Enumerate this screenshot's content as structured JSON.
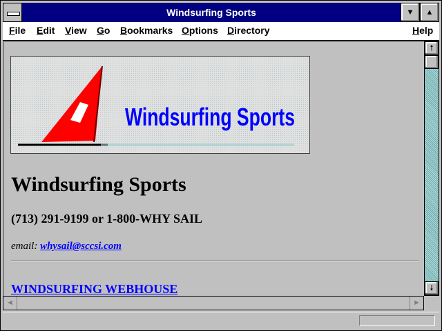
{
  "window": {
    "title": "Windsurfing Sports",
    "minimize_glyph": "▼",
    "maximize_glyph": "▲"
  },
  "menu": {
    "items": [
      {
        "label": "File",
        "u": "F"
      },
      {
        "label": "Edit",
        "u": "E"
      },
      {
        "label": "View",
        "u": "V"
      },
      {
        "label": "Go",
        "u": "G"
      },
      {
        "label": "Bookmarks",
        "u": "B"
      },
      {
        "label": "Options",
        "u": "O"
      },
      {
        "label": "Directory",
        "u": "D"
      },
      {
        "label": "Help",
        "u": "H"
      }
    ]
  },
  "page": {
    "banner_text": "Windsurfing Sports",
    "heading": "Windsurfing Sports",
    "phone": "(713) 291-9199 or 1-800-WHY SAIL",
    "email_label": "email:",
    "email_link": "whysail@sccsi.com",
    "webhouse_link": "WINDSURFING WEBHOUSE"
  },
  "scroll": {
    "up_glyph": "🠕",
    "down_glyph": "🠗",
    "left_glyph": "◄",
    "right_glyph": "►"
  },
  "colors": {
    "titlebar": "#000080",
    "sail": "#ff0000",
    "banner_text": "#0000ff",
    "link": "#0000ff"
  }
}
